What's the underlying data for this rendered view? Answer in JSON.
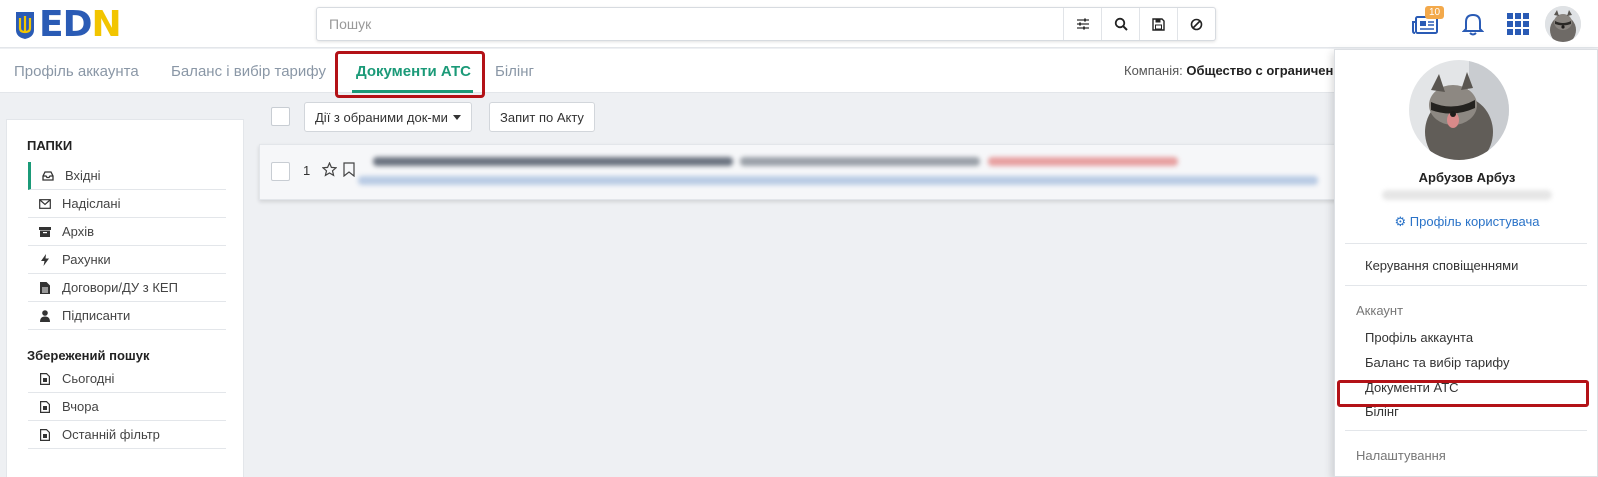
{
  "header": {
    "logo_text_e": "E",
    "logo_text_d": "D",
    "logo_text_n": "N",
    "search_placeholder": "Пошук",
    "notifications_badge": "10"
  },
  "tabs": [
    {
      "label": "Профіль аккаунта"
    },
    {
      "label": "Баланс і вибір тарифу"
    },
    {
      "label": "Документи АТС"
    },
    {
      "label": "Білінг"
    }
  ],
  "company": {
    "label": "Компанія:",
    "value": "Общество с ограниченн"
  },
  "sidebar": {
    "folders_title": "ПАПКИ",
    "folders": [
      {
        "label": "Вхідні",
        "icon": "inbox-icon"
      },
      {
        "label": "Надіслані",
        "icon": "envelope-icon"
      },
      {
        "label": "Архів",
        "icon": "archive-icon"
      },
      {
        "label": "Рахунки",
        "icon": "bolt-icon"
      },
      {
        "label": "Договори/ДУ з КЕП",
        "icon": "file-icon"
      },
      {
        "label": "Підписанти",
        "icon": "user-icon"
      }
    ],
    "saved_title": "Збережений пошук",
    "saved": [
      {
        "label": "Сьогодні"
      },
      {
        "label": "Вчора"
      },
      {
        "label": "Останній фільтр"
      }
    ]
  },
  "toolbar": {
    "actions_label": "Дії з обраними док-ми",
    "act_request_label": "Запит по Акту"
  },
  "documents": [
    {
      "number": "1"
    }
  ],
  "dropdown": {
    "user_name": "Арбузов Арбуз",
    "profile_link": "Профіль користувача",
    "notifications_item": "Керування сповіщеннями",
    "account_heading": "Аккаунт",
    "account_items": [
      {
        "label": "Профіль аккаунта"
      },
      {
        "label": "Баланс та вибір тарифу"
      },
      {
        "label": "Документи АТС"
      },
      {
        "label": "Білінг"
      }
    ],
    "settings_heading": "Налаштування"
  },
  "colors": {
    "accent": "#1b9a78",
    "highlight_box": "#b31217",
    "link": "#2a73c8",
    "brand_blue": "#2a5bb5",
    "brand_yellow": "#f2c500",
    "badge": "#f3a94b"
  }
}
